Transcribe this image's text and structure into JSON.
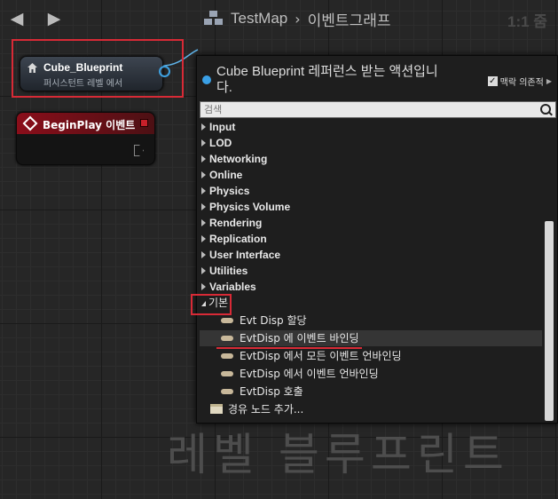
{
  "breadcrumb": {
    "map": "TestMap",
    "separator": "›",
    "graph": "이벤트그래프"
  },
  "zoom": "1:1 줌",
  "nodes": {
    "ref": {
      "name": "Cube_Blueprint",
      "subtitle": "퍼시스턴트 레벨 에서"
    },
    "event": {
      "name": "BeginPlay 이벤트"
    }
  },
  "menu": {
    "title": "Cube Blueprint 레퍼런스 받는 액션입니다.",
    "context_label": "맥락 의존적",
    "context_checked": true,
    "search_placeholder": "검색",
    "categories": [
      "Input",
      "LOD",
      "Networking",
      "Online",
      "Physics",
      "Physics Volume",
      "Rendering",
      "Replication",
      "User Interface",
      "Utilities",
      "Variables"
    ],
    "open_category": "기본",
    "functions": [
      "Evt Disp 할당",
      "EvtDisp 에 이벤트 바인딩",
      "EvtDisp 에서 모든 이벤트 언바인딩",
      "EvtDisp 에서 이벤트 언바인딩",
      "EvtDisp 호출"
    ],
    "selected_function_index": 1,
    "comment_item": "경유 노드 추가..."
  },
  "watermark": "레벨 블루프린트",
  "colors": {
    "highlight": "#d82a36",
    "pin": "#3ea0e0",
    "event_header": "#8a0e1a"
  }
}
